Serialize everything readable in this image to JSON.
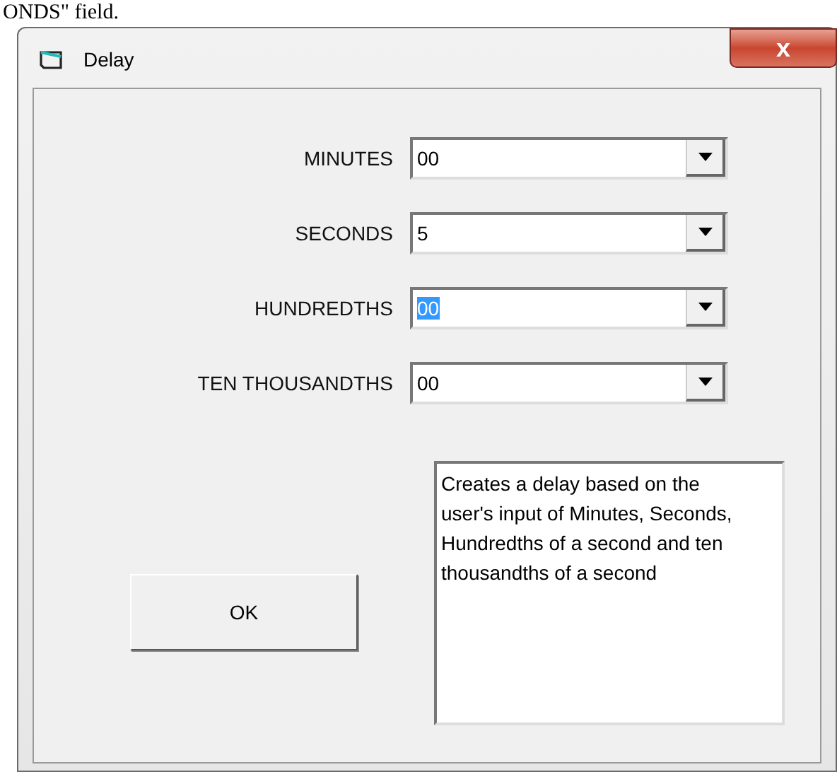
{
  "document_text": "ONDS\" field.",
  "window": {
    "title": "Delay",
    "close_label": "x"
  },
  "fields": [
    {
      "label": "MINUTES",
      "value": "00",
      "text_selected": false
    },
    {
      "label": "SECONDS",
      "value": "5",
      "text_selected": false
    },
    {
      "label": "HUNDREDTHS",
      "value": "00",
      "text_selected": true
    },
    {
      "label": "TEN THOUSANDTHS",
      "value": "00",
      "text_selected": false
    }
  ],
  "ok_button": "OK",
  "description": "Creates a delay based on the user's input of Minutes, Seconds, Hundredths of a second and ten thousandths of a second"
}
